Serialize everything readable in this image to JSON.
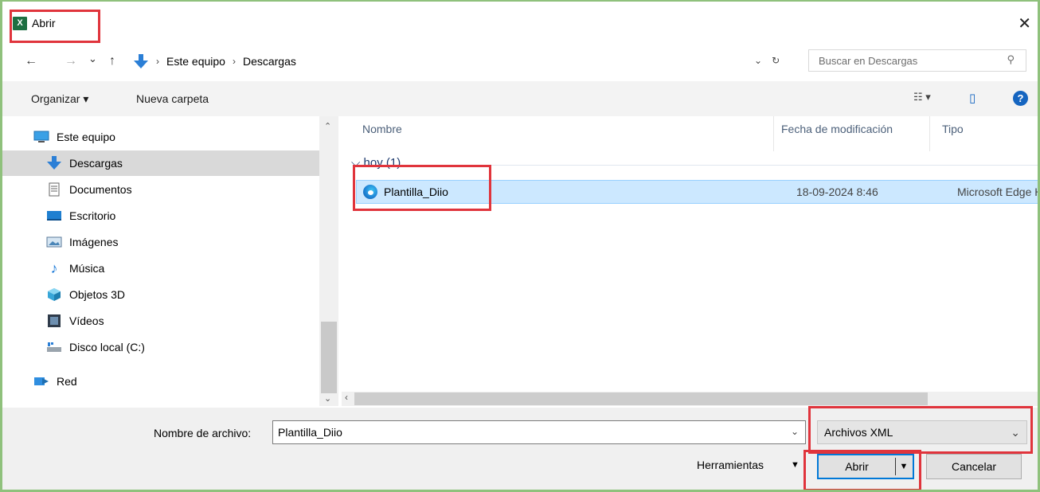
{
  "window": {
    "title": "Abrir",
    "app_icon_letter": "X",
    "close_glyph": "✕"
  },
  "address": {
    "back": "←",
    "forward": "→",
    "recent": "⌄",
    "up": "↑",
    "crumbs": [
      "Este equipo",
      "Descargas"
    ],
    "separator": "›",
    "dropdown": "⌄",
    "refresh": "↻"
  },
  "search": {
    "placeholder": "Buscar en Descargas",
    "icon": "⚲"
  },
  "toolbar": {
    "organize": "Organizar ▾",
    "new_folder": "Nueva carpeta",
    "view_options": "☷ ▾",
    "preview_pane": "▯",
    "help": "?"
  },
  "nav": {
    "items": [
      {
        "label": "Este equipo",
        "icon": "computer-icon"
      },
      {
        "label": "Descargas",
        "icon": "download-icon",
        "selected": true
      },
      {
        "label": "Documentos",
        "icon": "document-icon"
      },
      {
        "label": "Escritorio",
        "icon": "desktop-icon"
      },
      {
        "label": "Imágenes",
        "icon": "pictures-icon"
      },
      {
        "label": "Música",
        "icon": "music-icon"
      },
      {
        "label": "Objetos 3D",
        "icon": "objects3d-icon"
      },
      {
        "label": "Vídeos",
        "icon": "videos-icon"
      },
      {
        "label": "Disco local (C:)",
        "icon": "drive-icon"
      },
      {
        "label": "Red",
        "icon": "network-icon"
      }
    ]
  },
  "files": {
    "columns": {
      "name": "Nombre",
      "date": "Fecha de modificación",
      "type": "Tipo"
    },
    "group": "hoy (1)",
    "rows": [
      {
        "name": "Plantilla_Diio",
        "date": "18-09-2024 8:46",
        "type": "Microsoft Edge H...",
        "icon": "edge-icon"
      }
    ]
  },
  "bottom": {
    "filename_label": "Nombre de archivo:",
    "filename_value": "Plantilla_Diio",
    "filetype_value": "Archivos XML",
    "tools_label": "Herramientas",
    "open_label": "Abrir",
    "cancel_label": "Cancelar"
  },
  "colors": {
    "frame_green": "#8fc17c",
    "annotation_red": "#e0343c",
    "selection_blue": "#cce8ff",
    "excel_green": "#1d6f42"
  }
}
